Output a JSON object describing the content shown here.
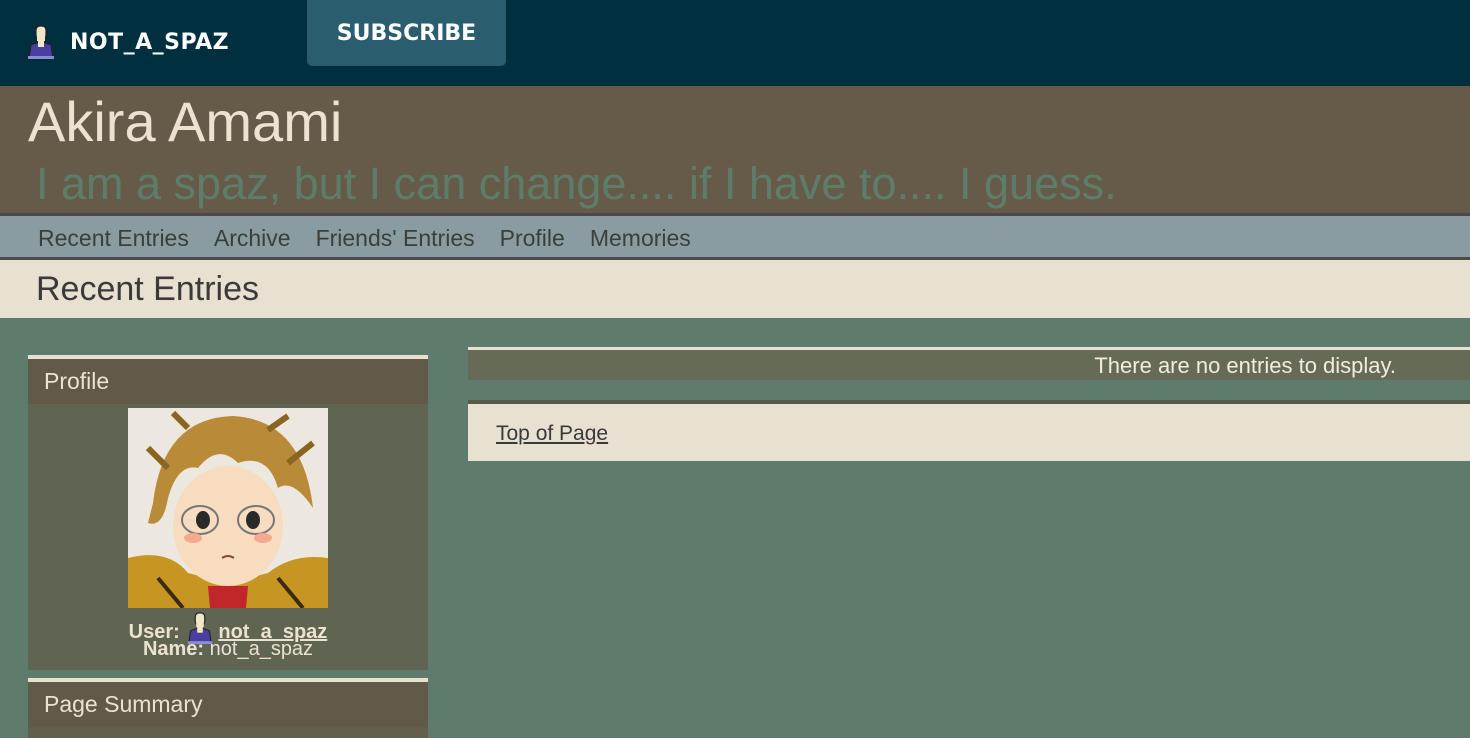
{
  "topbar": {
    "username": "NOT_A_SPAZ",
    "subscribe_label": "SUBSCRIBE"
  },
  "header": {
    "title": "Akira Amami",
    "subtitle": "I am a spaz, but I can change.... if I have to.... I guess."
  },
  "nav": {
    "items": [
      "Recent Entries",
      "Archive",
      "Friends' Entries",
      "Profile",
      "Memories"
    ]
  },
  "page": {
    "heading": "Recent Entries"
  },
  "sidebar": {
    "profile": {
      "header": "Profile",
      "user_label": "User:",
      "user_link": "not_a_spaz",
      "name_label": "Name:",
      "name_value": "not_a_spaz"
    },
    "summary": {
      "header": "Page Summary"
    }
  },
  "main": {
    "no_entries_text": "There are no entries to display.",
    "top_of_page": "Top of Page"
  },
  "icons": {
    "user": "user-icon",
    "userpic": "anime-avatar"
  },
  "colors": {
    "topbar": "#002f3f",
    "subscribe": "#2a5d6e",
    "header": "#655b48",
    "nav": "#8a9ca2",
    "background": "#5f7b6b"
  }
}
